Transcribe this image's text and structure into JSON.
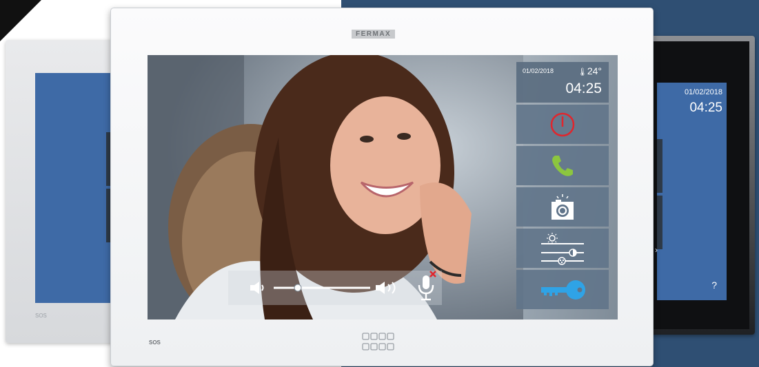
{
  "brand": "FERMAX",
  "main_screen": {
    "date": "01/02/2018",
    "temperature": "24°",
    "time": "04:25",
    "buttons": [
      {
        "name": "power",
        "icon": "power-icon",
        "color": "#e0262d"
      },
      {
        "name": "call",
        "icon": "phone-icon",
        "color": "#8cc63f"
      },
      {
        "name": "snapshot",
        "icon": "camera-icon",
        "color": "#ffffff"
      },
      {
        "name": "settings",
        "icon": "sliders-icon",
        "color": "#ffffff"
      },
      {
        "name": "door-open",
        "icon": "key-icon",
        "color": "#2fa3e6"
      }
    ],
    "volume_level": 0.25,
    "microphone": "muted"
  },
  "sos_label": "SOS",
  "right_monitor": {
    "date": "01/02/2018",
    "time": "04:25",
    "help": "?"
  },
  "colors": {
    "screen_blue": "#3e6aa6",
    "panel_bg": "#60748a",
    "navy_background": "#2f4f73"
  }
}
